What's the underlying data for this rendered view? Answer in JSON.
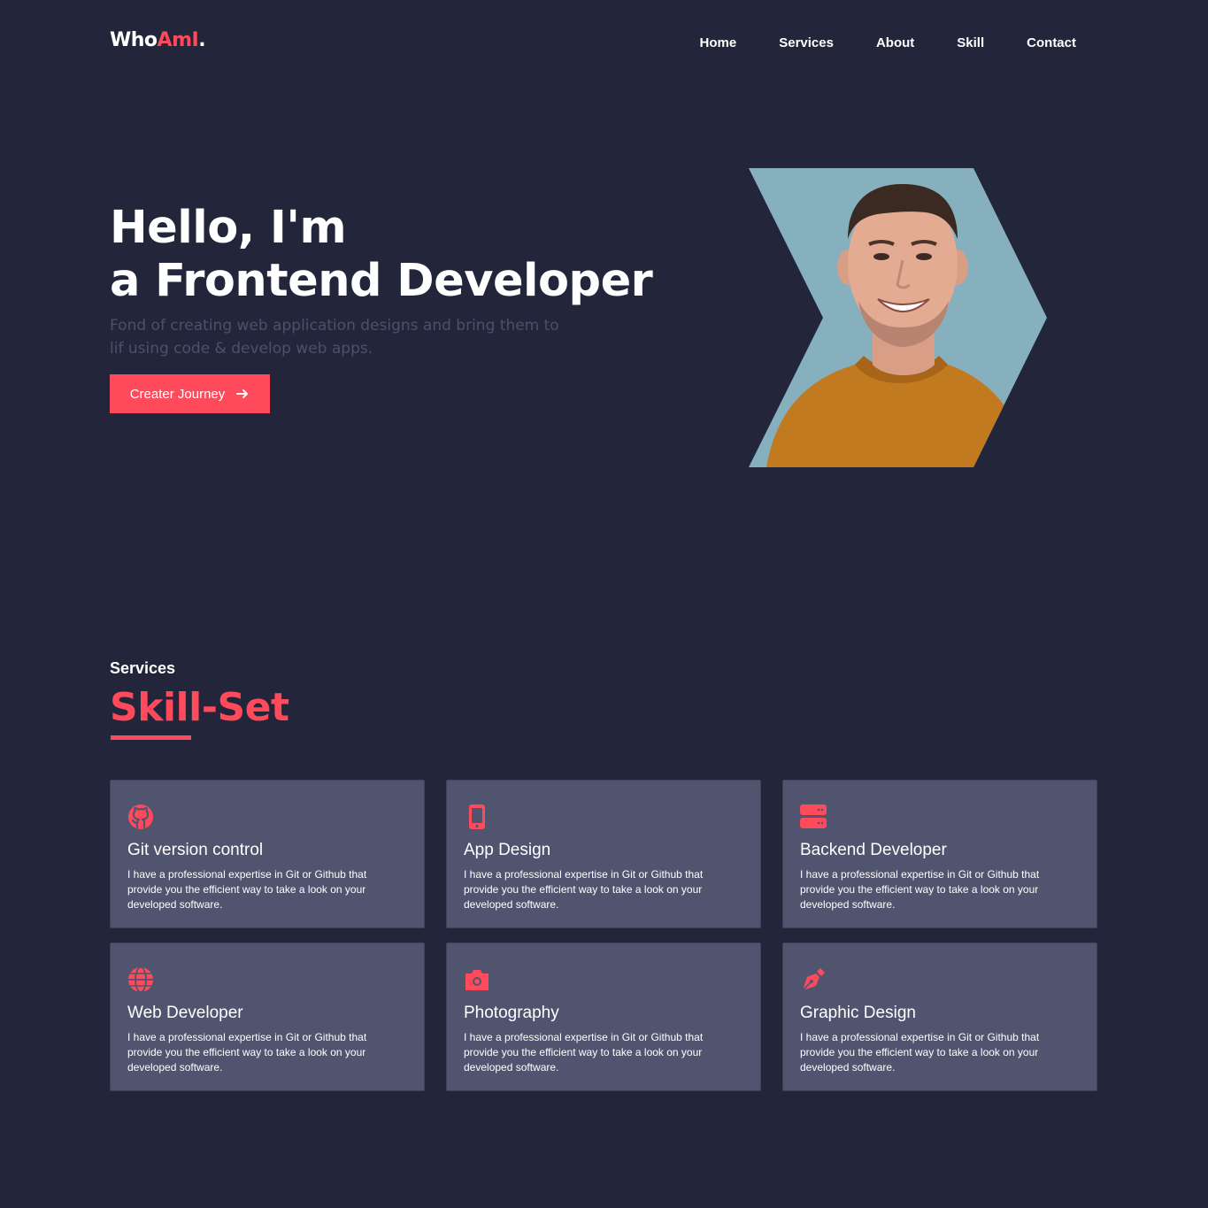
{
  "brand": {
    "logo_a": "Who",
    "logo_b": "AmI",
    "logo_c": "."
  },
  "nav": [
    {
      "label": "Home"
    },
    {
      "label": "Services"
    },
    {
      "label": "About"
    },
    {
      "label": "Skill"
    },
    {
      "label": "Contact"
    }
  ],
  "hero": {
    "line1": "Hello, I'm",
    "line2": "a Frontend Developer",
    "subtitle": "Fond of creating web application designs and bring them to lif using code & develop web apps.",
    "cta": "Creater Journey"
  },
  "services": {
    "label": "Services",
    "title": "Skill-Set",
    "cards": [
      {
        "icon": "github-icon",
        "title": "Git version control",
        "text": "I have a professional expertise in Git or Github that provide you the efficient way to take a look on your developed software."
      },
      {
        "icon": "mobile-icon",
        "title": "App Design",
        "text": "I have a professional expertise in Git or Github that provide you the efficient way to take a look on your developed software."
      },
      {
        "icon": "server-icon",
        "title": "Backend Developer",
        "text": "I have a professional expertise in Git or Github that provide you the efficient way to take a look on your developed software."
      },
      {
        "icon": "globe-icon",
        "title": "Web Developer",
        "text": "I have a professional expertise in Git or Github that provide you the efficient way to take a look on your developed software."
      },
      {
        "icon": "camera-icon",
        "title": "Photography",
        "text": "I have a professional expertise in Git or Github that provide you the efficient way to take a look on your developed software."
      },
      {
        "icon": "pen-nib-icon",
        "title": "Graphic Design",
        "text": "I have a professional expertise in Git or Github that provide you the efficient way to take a look on your developed software."
      }
    ]
  },
  "colors": {
    "background": "#23253a",
    "accent": "#fe4a5b",
    "card": "#50546e",
    "portrait_bg": "#86b0bd",
    "shirt": "#c17a1f"
  }
}
